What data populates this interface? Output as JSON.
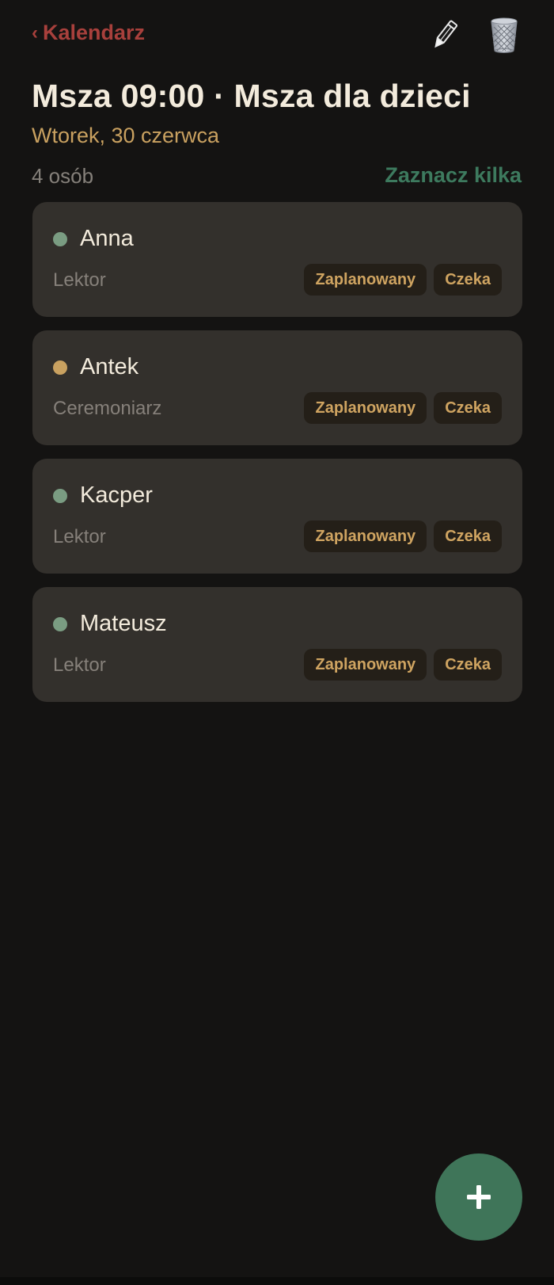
{
  "colors": {
    "background": "#141312",
    "card": "#33302c",
    "back_link": "#a8403c",
    "title": "#f3ebdc",
    "subtitle": "#c9a160",
    "select_multi": "#3d7a5e",
    "badge_bg": "#241f18",
    "badge_text": "#cfa461",
    "fab": "#3f7559",
    "status_green": "#7a9c82",
    "status_gold": "#c9a160"
  },
  "header": {
    "back_chevron": "‹",
    "back_label": "Kalendarz",
    "back_icon": "chevron-left-icon",
    "edit_icon": "pencil-icon",
    "delete_icon": "trash-icon"
  },
  "event": {
    "title": "Msza 09:00 · Msza dla dzieci",
    "date": "Wtorek, 30 czerwca",
    "people_count": "4 osób",
    "select_multiple": "Zaznacz kilka"
  },
  "people": [
    {
      "name": "Anna",
      "role": "Lektor",
      "dot_color": "#7a9c82",
      "badges": [
        "Zaplanowany",
        "Czeka"
      ]
    },
    {
      "name": "Antek",
      "role": "Ceremoniarz",
      "dot_color": "#c9a160",
      "badges": [
        "Zaplanowany",
        "Czeka"
      ]
    },
    {
      "name": "Kacper",
      "role": "Lektor",
      "dot_color": "#7a9c82",
      "badges": [
        "Zaplanowany",
        "Czeka"
      ]
    },
    {
      "name": "Mateusz",
      "role": "Lektor",
      "dot_color": "#7a9c82",
      "badges": [
        "Zaplanowany",
        "Czeka"
      ]
    }
  ],
  "fab": {
    "icon": "plus-icon"
  }
}
